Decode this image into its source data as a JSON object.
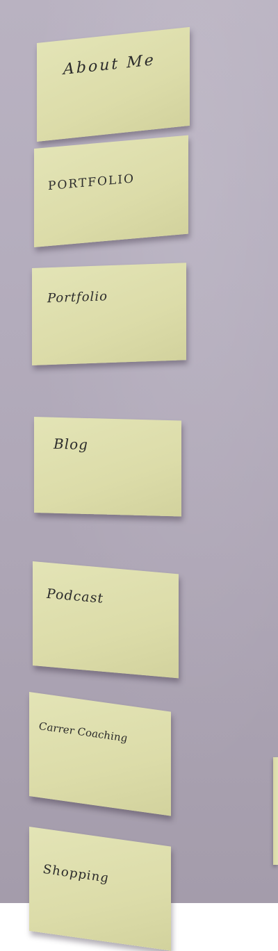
{
  "scene": "wall-of-sticky-notes",
  "notes": [
    {
      "label": "About Me"
    },
    {
      "label": "PORTFOLIO"
    },
    {
      "label": "Portfolio"
    },
    {
      "label": "Blog"
    },
    {
      "label": "Podcast"
    },
    {
      "label": "Carrer Coaching"
    },
    {
      "label": "Shopping"
    }
  ],
  "colors": {
    "wall": "#b4adbd",
    "note": "#dcdca9",
    "ink": "#2b2b2b"
  }
}
